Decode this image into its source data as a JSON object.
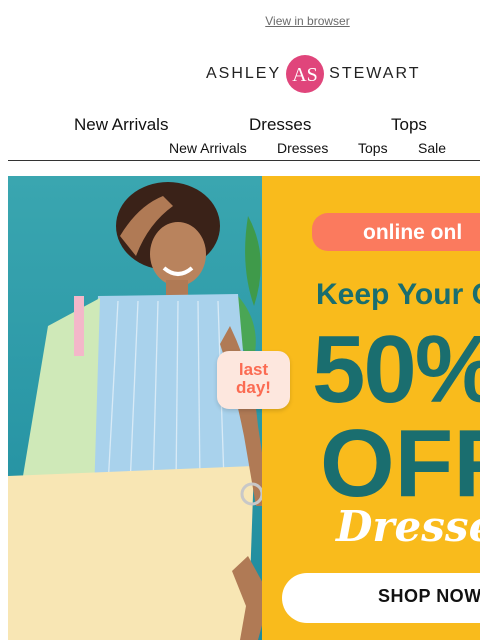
{
  "header": {
    "view_in_browser": "View in browser",
    "logo_left": "ASHLEY",
    "logo_mark": "AS",
    "logo_right": "STEWART"
  },
  "nav_primary": [
    "New Arrivals",
    "Dresses",
    "Tops"
  ],
  "nav_secondary": [
    "New Arrivals",
    "Dresses",
    "Tops",
    "Sale"
  ],
  "hero": {
    "badge_line1": "last",
    "badge_line2": "day!",
    "online_only": "online onl",
    "headline": "Keep Your C",
    "discount": "50%",
    "off": "OFF",
    "category": "Dresse",
    "cta": "SHOP NOW"
  },
  "colors": {
    "promo_bg": "#f9bb1c",
    "teal": "#1a6e6f",
    "coral": "#fb7a5e",
    "logo_pink": "#e0457b"
  }
}
